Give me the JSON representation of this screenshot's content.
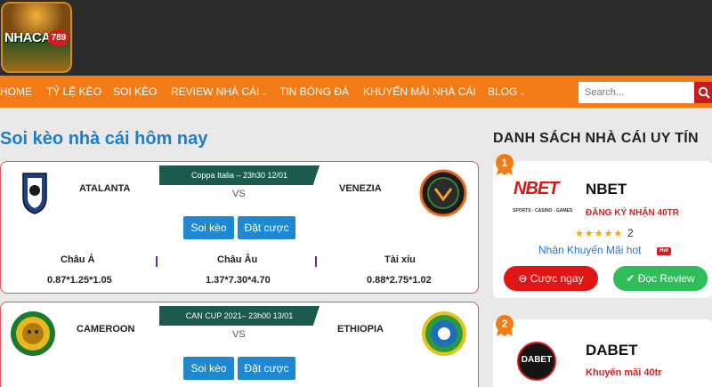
{
  "header": {
    "logo_text": "NHACAI",
    "logo_number": "789"
  },
  "nav": {
    "items": [
      "HOME",
      "TỶ LỆ KÈO",
      "SOI KÈO",
      "REVIEW NHÀ CÁI",
      "TIN BÓNG ĐÁ",
      "KHUYẾN MÃI NHÀ CÁI",
      "BLOG"
    ],
    "search_placeholder": "Search..."
  },
  "main": {
    "title": "Soi kèo nhà cái hôm nay",
    "matches": [
      {
        "competition": "Coppa Italia – 23h30 12/01",
        "home": "ATALANTA",
        "away": "VENEZIA",
        "vs": "VS",
        "btn_soikeo": "Soi kèo",
        "btn_datcuoc": "Đặt cược",
        "odds_labels": [
          "Châu Á",
          "Châu Âu",
          "Tài xỉu"
        ],
        "odds_values": [
          "0.87*1.25*1.05",
          "1.37*7.30*4.70",
          "0.88*2.75*1.02"
        ]
      },
      {
        "competition": "CAN CUP 2021– 23h00 13/01",
        "home": "CAMEROON",
        "away": "ETHIOPIA",
        "vs": "VS",
        "btn_soikeo": "Soi kèo",
        "btn_datcuoc": "Đặt cược"
      }
    ]
  },
  "sidebar": {
    "title": "DANH SÁCH NHÀ CÁI UY TÍN",
    "cards": [
      {
        "rank": "1",
        "name": "NBET",
        "logo_text": "NBET",
        "logo_sub": "SPORTS - CASINO - GAMES",
        "subtitle": "ĐĂNG KÝ NHẬN 40TR",
        "stars": "★★★★★",
        "rating": "2",
        "promo": "Nhận Khuyến Mãi hot",
        "hot_badge": "Hot",
        "btn_bet": "Cược ngay",
        "btn_review": "Đọc Review"
      },
      {
        "rank": "2",
        "name": "DABET",
        "logo_text": "DABET",
        "subtitle": "Khuyến mãi 40tr"
      }
    ]
  },
  "colors": {
    "nav_bg": "#f47a16",
    "title_blue": "#1f7ec9",
    "button_blue": "#1e88d2",
    "bet_red": "#e01616",
    "review_green": "#2ebd59",
    "banner_green": "#1d5a4e"
  }
}
